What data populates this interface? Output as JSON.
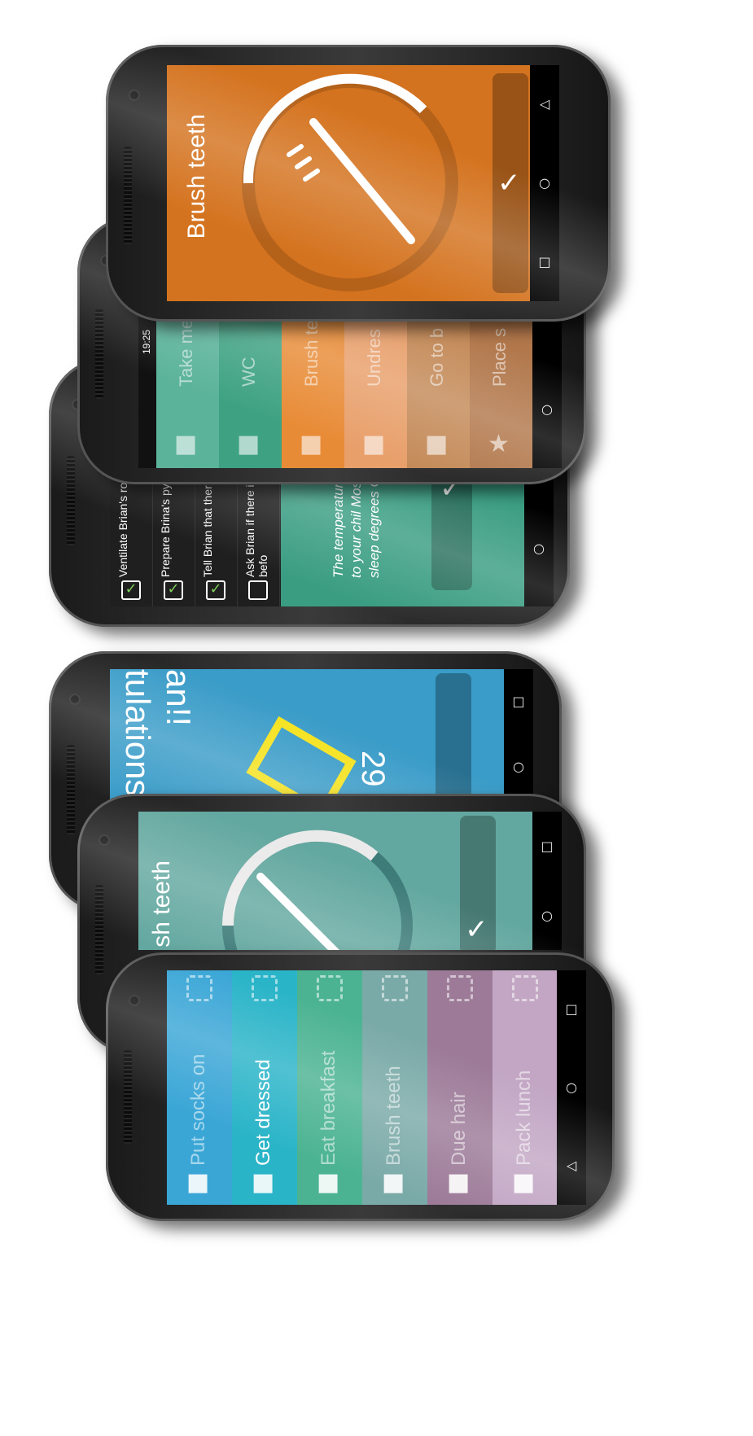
{
  "colors": {
    "orange": "#d4731f",
    "blue": "#3a9cc8",
    "teal": "#63a8a0",
    "green": "#3a9d82",
    "yellow": "#f5e21c"
  },
  "brush_screen": {
    "title": "Brush teeth",
    "progress": 0.35
  },
  "list_screen": {
    "time": "19:25",
    "items": [
      {
        "label": "Take medi",
        "icon": "pill-icon",
        "color": "#5bb39a"
      },
      {
        "label": "WC",
        "icon": "toilet-icon",
        "color": "#3ea282"
      },
      {
        "label": "Brush te",
        "icon": "toothbrush-icon",
        "color": "#e88b36"
      },
      {
        "label": "Undres",
        "icon": "clothes-icon",
        "color": "#e89f6a"
      },
      {
        "label": "Go to b",
        "icon": "bed-icon",
        "color": "#c48a58"
      },
      {
        "label": "Place s",
        "icon": "star-icon",
        "color": "#b2784c"
      }
    ]
  },
  "checklist_screen": {
    "items": [
      {
        "label": "Ventilate Brian's ro",
        "checked": true
      },
      {
        "label": "Prepare Brina's pyj",
        "checked": true
      },
      {
        "label": "Tell Brian that ther bed time.",
        "checked": true
      },
      {
        "label": "Ask Brian if there is do or talk about befo",
        "checked": false
      }
    ],
    "tip": "The temperature in related to your chil Most people sleep degrees C"
  },
  "congrats_screen": {
    "line1": "tulations",
    "line2": "an!!",
    "number": "29"
  },
  "teal_screen": {
    "title": "sh teeth"
  },
  "routine_screen": {
    "items": [
      {
        "label": "Put socks on",
        "icon": "sock-icon",
        "color": "#3aa6d6",
        "checked": true
      },
      {
        "label": "Get dressed",
        "icon": "shirt-icon",
        "color": "#2ab4c8",
        "checked": false
      },
      {
        "label": "Eat breakfast",
        "icon": "plate-icon",
        "color": "#4bb392",
        "checked": false
      },
      {
        "label": "Brush teeth",
        "icon": "toothbrush-icon",
        "color": "#7aaaa8",
        "checked": false
      },
      {
        "label": "Due hair",
        "icon": "hair-icon",
        "color": "#9c7a98",
        "checked": false
      },
      {
        "label": "Pack lunch",
        "icon": "lunchbox-icon",
        "color": "#c2a6c4",
        "checked": false
      }
    ]
  }
}
